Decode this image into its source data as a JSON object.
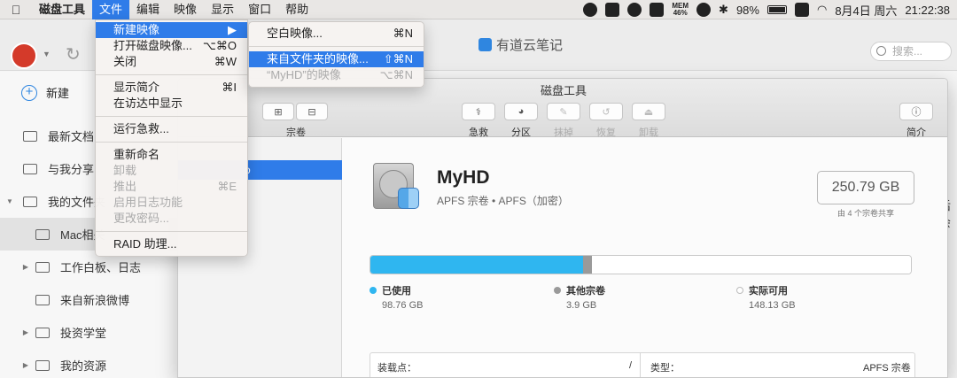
{
  "menubar": {
    "app_name": "磁盘工具",
    "items": [
      "文件",
      "编辑",
      "映像",
      "显示",
      "窗口",
      "帮助"
    ],
    "active_item": "文件",
    "status": {
      "mem_label": "MEM",
      "mem_value": "46%",
      "battery": "98%",
      "battery_level": 0.98,
      "date": "8月4日 周六",
      "time": "21:22:38"
    }
  },
  "file_menu": {
    "items": [
      {
        "label": "新建映像",
        "shortcut": "▶",
        "state": "highlighted"
      },
      {
        "label": "打开磁盘映像...",
        "shortcut": "⌥⌘O",
        "state": "enabled"
      },
      {
        "label": "关闭",
        "shortcut": "⌘W",
        "state": "enabled"
      },
      {
        "label": "显示简介",
        "shortcut": "⌘I",
        "state": "enabled"
      },
      {
        "label": "在访达中显示",
        "shortcut": "",
        "state": "enabled"
      },
      {
        "label": "运行急救...",
        "shortcut": "",
        "state": "enabled"
      },
      {
        "label": "重新命名",
        "shortcut": "",
        "state": "enabled"
      },
      {
        "label": "卸载",
        "shortcut": "",
        "state": "disabled"
      },
      {
        "label": "推出",
        "shortcut": "⌘E",
        "state": "disabled"
      },
      {
        "label": "启用日志功能",
        "shortcut": "",
        "state": "disabled"
      },
      {
        "label": "更改密码...",
        "shortcut": "",
        "state": "disabled"
      },
      {
        "label": "RAID 助理...",
        "shortcut": "",
        "state": "enabled"
      }
    ]
  },
  "submenu": {
    "items": [
      {
        "label": "空白映像...",
        "shortcut": "⌘N",
        "state": "enabled"
      },
      {
        "label": "来自文件夹的映像...",
        "shortcut": "⇧⌘N",
        "state": "highlighted"
      },
      {
        "label": "“MyHD”的映像",
        "shortcut": "⌥⌘N",
        "state": "disabled"
      }
    ]
  },
  "note_app": {
    "title": "有道云笔记",
    "search_placeholder": "搜索...",
    "new_label": "新建",
    "nav": [
      {
        "label": "最新文档"
      },
      {
        "label": "与我分享"
      },
      {
        "label": "我的文件夹"
      },
      {
        "label": "Mac相关"
      },
      {
        "label": "工作白板、日志"
      },
      {
        "label": "来自新浪微博"
      },
      {
        "label": "投资学堂"
      },
      {
        "label": "我的资源"
      }
    ],
    "right_text": "后会"
  },
  "disk_utility": {
    "title": "磁盘工具",
    "toolbar": {
      "volume_label": "宗卷",
      "first_aid": "急救",
      "partition": "分区",
      "erase": "抹掉",
      "restore": "恢复",
      "unmount": "卸载",
      "info": "简介"
    },
    "sidebar_selected": "o",
    "volume": {
      "name": "MyHD",
      "subtitle": "APFS 宗卷 • APFS（加密）",
      "capacity": "250.79 GB",
      "capacity_note": "由 4 个宗卷共享"
    },
    "usage": [
      {
        "label": "已使用",
        "value": "98.76 GB",
        "gb": 98.76,
        "color": "#2fb6f0"
      },
      {
        "label": "其他宗卷",
        "value": "3.9 GB",
        "gb": 3.9,
        "color": "#9a9a9a"
      },
      {
        "label": "实际可用",
        "value": "148.13 GB",
        "gb": 148.13,
        "color": "#ffffff"
      }
    ],
    "info": {
      "mount_label": "装载点：",
      "mount_value": "/",
      "type_label": "类型：",
      "type_value": "APFS 宗卷"
    }
  }
}
